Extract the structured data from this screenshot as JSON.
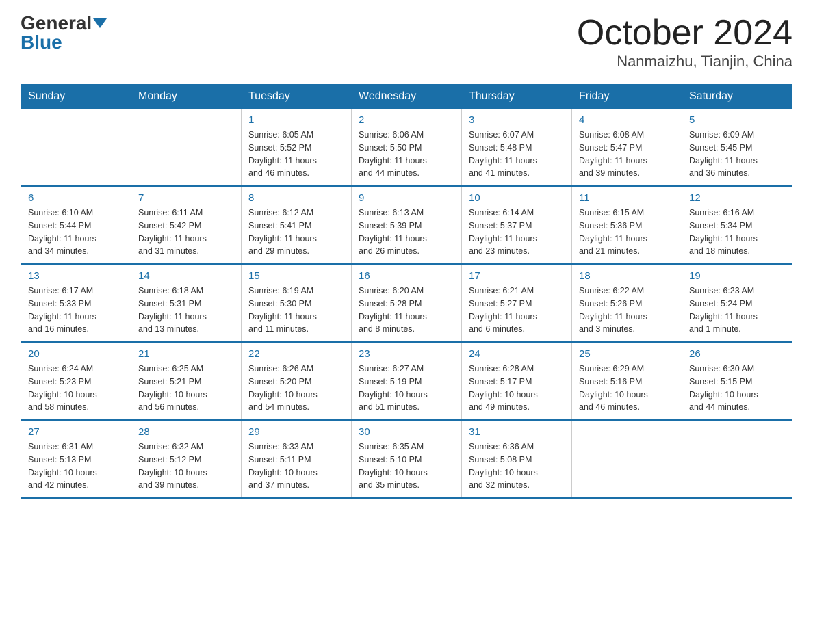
{
  "logo": {
    "general": "General",
    "blue": "Blue"
  },
  "title": "October 2024",
  "subtitle": "Nanmaizhu, Tianjin, China",
  "days_of_week": [
    "Sunday",
    "Monday",
    "Tuesday",
    "Wednesday",
    "Thursday",
    "Friday",
    "Saturday"
  ],
  "weeks": [
    [
      {
        "day": "",
        "info": ""
      },
      {
        "day": "",
        "info": ""
      },
      {
        "day": "1",
        "info": "Sunrise: 6:05 AM\nSunset: 5:52 PM\nDaylight: 11 hours\nand 46 minutes."
      },
      {
        "day": "2",
        "info": "Sunrise: 6:06 AM\nSunset: 5:50 PM\nDaylight: 11 hours\nand 44 minutes."
      },
      {
        "day": "3",
        "info": "Sunrise: 6:07 AM\nSunset: 5:48 PM\nDaylight: 11 hours\nand 41 minutes."
      },
      {
        "day": "4",
        "info": "Sunrise: 6:08 AM\nSunset: 5:47 PM\nDaylight: 11 hours\nand 39 minutes."
      },
      {
        "day": "5",
        "info": "Sunrise: 6:09 AM\nSunset: 5:45 PM\nDaylight: 11 hours\nand 36 minutes."
      }
    ],
    [
      {
        "day": "6",
        "info": "Sunrise: 6:10 AM\nSunset: 5:44 PM\nDaylight: 11 hours\nand 34 minutes."
      },
      {
        "day": "7",
        "info": "Sunrise: 6:11 AM\nSunset: 5:42 PM\nDaylight: 11 hours\nand 31 minutes."
      },
      {
        "day": "8",
        "info": "Sunrise: 6:12 AM\nSunset: 5:41 PM\nDaylight: 11 hours\nand 29 minutes."
      },
      {
        "day": "9",
        "info": "Sunrise: 6:13 AM\nSunset: 5:39 PM\nDaylight: 11 hours\nand 26 minutes."
      },
      {
        "day": "10",
        "info": "Sunrise: 6:14 AM\nSunset: 5:37 PM\nDaylight: 11 hours\nand 23 minutes."
      },
      {
        "day": "11",
        "info": "Sunrise: 6:15 AM\nSunset: 5:36 PM\nDaylight: 11 hours\nand 21 minutes."
      },
      {
        "day": "12",
        "info": "Sunrise: 6:16 AM\nSunset: 5:34 PM\nDaylight: 11 hours\nand 18 minutes."
      }
    ],
    [
      {
        "day": "13",
        "info": "Sunrise: 6:17 AM\nSunset: 5:33 PM\nDaylight: 11 hours\nand 16 minutes."
      },
      {
        "day": "14",
        "info": "Sunrise: 6:18 AM\nSunset: 5:31 PM\nDaylight: 11 hours\nand 13 minutes."
      },
      {
        "day": "15",
        "info": "Sunrise: 6:19 AM\nSunset: 5:30 PM\nDaylight: 11 hours\nand 11 minutes."
      },
      {
        "day": "16",
        "info": "Sunrise: 6:20 AM\nSunset: 5:28 PM\nDaylight: 11 hours\nand 8 minutes."
      },
      {
        "day": "17",
        "info": "Sunrise: 6:21 AM\nSunset: 5:27 PM\nDaylight: 11 hours\nand 6 minutes."
      },
      {
        "day": "18",
        "info": "Sunrise: 6:22 AM\nSunset: 5:26 PM\nDaylight: 11 hours\nand 3 minutes."
      },
      {
        "day": "19",
        "info": "Sunrise: 6:23 AM\nSunset: 5:24 PM\nDaylight: 11 hours\nand 1 minute."
      }
    ],
    [
      {
        "day": "20",
        "info": "Sunrise: 6:24 AM\nSunset: 5:23 PM\nDaylight: 10 hours\nand 58 minutes."
      },
      {
        "day": "21",
        "info": "Sunrise: 6:25 AM\nSunset: 5:21 PM\nDaylight: 10 hours\nand 56 minutes."
      },
      {
        "day": "22",
        "info": "Sunrise: 6:26 AM\nSunset: 5:20 PM\nDaylight: 10 hours\nand 54 minutes."
      },
      {
        "day": "23",
        "info": "Sunrise: 6:27 AM\nSunset: 5:19 PM\nDaylight: 10 hours\nand 51 minutes."
      },
      {
        "day": "24",
        "info": "Sunrise: 6:28 AM\nSunset: 5:17 PM\nDaylight: 10 hours\nand 49 minutes."
      },
      {
        "day": "25",
        "info": "Sunrise: 6:29 AM\nSunset: 5:16 PM\nDaylight: 10 hours\nand 46 minutes."
      },
      {
        "day": "26",
        "info": "Sunrise: 6:30 AM\nSunset: 5:15 PM\nDaylight: 10 hours\nand 44 minutes."
      }
    ],
    [
      {
        "day": "27",
        "info": "Sunrise: 6:31 AM\nSunset: 5:13 PM\nDaylight: 10 hours\nand 42 minutes."
      },
      {
        "day": "28",
        "info": "Sunrise: 6:32 AM\nSunset: 5:12 PM\nDaylight: 10 hours\nand 39 minutes."
      },
      {
        "day": "29",
        "info": "Sunrise: 6:33 AM\nSunset: 5:11 PM\nDaylight: 10 hours\nand 37 minutes."
      },
      {
        "day": "30",
        "info": "Sunrise: 6:35 AM\nSunset: 5:10 PM\nDaylight: 10 hours\nand 35 minutes."
      },
      {
        "day": "31",
        "info": "Sunrise: 6:36 AM\nSunset: 5:08 PM\nDaylight: 10 hours\nand 32 minutes."
      },
      {
        "day": "",
        "info": ""
      },
      {
        "day": "",
        "info": ""
      }
    ]
  ]
}
